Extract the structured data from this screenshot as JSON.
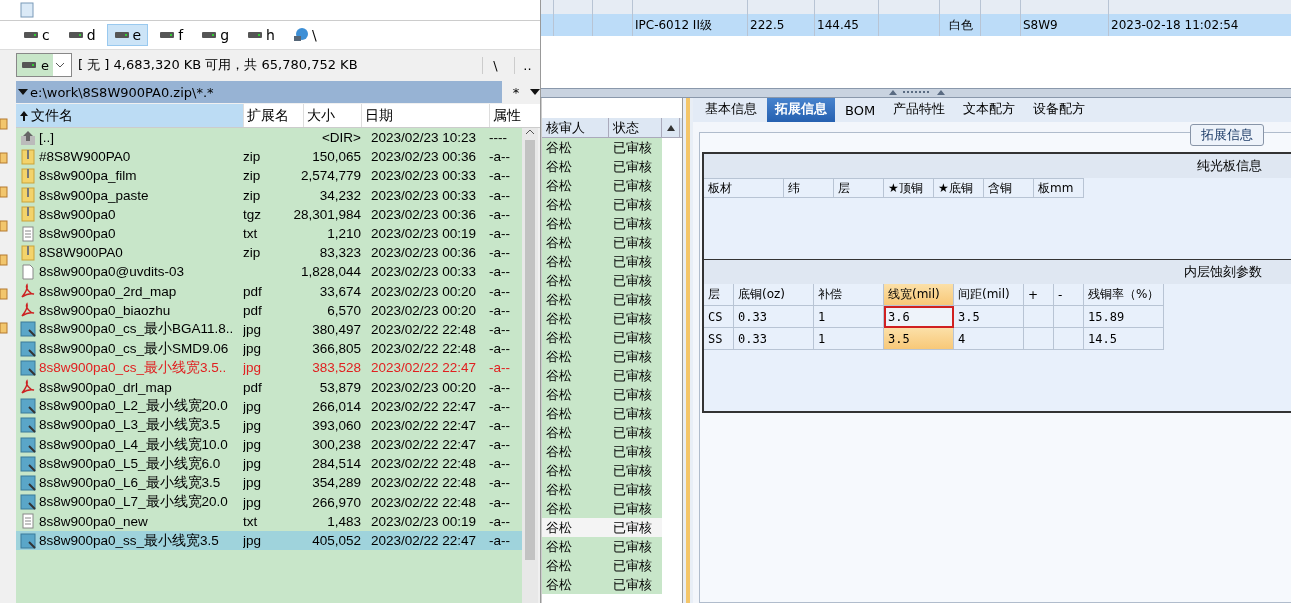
{
  "file_panel": {
    "drives": [
      {
        "kind": "drive",
        "label": "c",
        "selected": false
      },
      {
        "kind": "drive",
        "label": "d",
        "selected": false
      },
      {
        "kind": "drive",
        "label": "e",
        "selected": true
      },
      {
        "kind": "drive",
        "label": "f",
        "selected": false
      },
      {
        "kind": "drive",
        "label": "g",
        "selected": false
      },
      {
        "kind": "drive",
        "label": "h",
        "selected": false
      },
      {
        "kind": "network",
        "label": "\\",
        "selected": false
      }
    ],
    "drive_select": {
      "value": "e"
    },
    "free_space": "[ 无 ]  4,683,320 KB 可用，共 65,780,752 KB",
    "root_button": "\\",
    "up_button": "..",
    "path": "e:\\work\\8S8W900PA0.zip\\*.*",
    "filter": "*",
    "columns": [
      "文件名",
      "扩展名",
      "大小",
      "日期",
      "属性"
    ],
    "files": [
      {
        "kind": "up",
        "name": "[..]",
        "size": "<DIR>",
        "date": "2023/02/23 10:23",
        "attr": "----",
        "marked": false,
        "selected": false
      },
      {
        "kind": "zip",
        "name": "#8S8W900PA0",
        "ext": "zip",
        "size": "150,065",
        "date": "2023/02/23 00:36",
        "attr": "-a--",
        "marked": false,
        "selected": false
      },
      {
        "kind": "zip",
        "name": "8s8w900pa_film",
        "ext": "zip",
        "size": "2,574,779",
        "date": "2023/02/23 00:33",
        "attr": "-a--",
        "marked": false,
        "selected": false
      },
      {
        "kind": "zip",
        "name": "8s8w900pa_paste",
        "ext": "zip",
        "size": "34,232",
        "date": "2023/02/23 00:33",
        "attr": "-a--",
        "marked": false,
        "selected": false
      },
      {
        "kind": "zip",
        "name": "8s8w900pa0",
        "ext": "tgz",
        "size": "28,301,984",
        "date": "2023/02/23 00:36",
        "attr": "-a--",
        "marked": false,
        "selected": false
      },
      {
        "kind": "txt",
        "name": "8s8w900pa0",
        "ext": "txt",
        "size": "1,210",
        "date": "2023/02/23 00:19",
        "attr": "-a--",
        "marked": false,
        "selected": false
      },
      {
        "kind": "zip",
        "name": "8S8W900PA0",
        "ext": "zip",
        "size": "83,323",
        "date": "2023/02/23 00:36",
        "attr": "-a--",
        "marked": false,
        "selected": false
      },
      {
        "kind": "file",
        "name": "8s8w900pa0@uvdits-03",
        "size": "1,828,044",
        "date": "2023/02/23 00:33",
        "attr": "-a--",
        "marked": false,
        "selected": false
      },
      {
        "kind": "pdf",
        "name": "8s8w900pa0_2rd_map",
        "ext": "pdf",
        "size": "33,674",
        "date": "2023/02/23 00:20",
        "attr": "-a--",
        "marked": false,
        "selected": false
      },
      {
        "kind": "pdf",
        "name": "8s8w900pa0_biaozhu",
        "ext": "pdf",
        "size": "6,570",
        "date": "2023/02/23 00:20",
        "attr": "-a--",
        "marked": false,
        "selected": false
      },
      {
        "kind": "jpg",
        "name": "8s8w900pa0_cs_最小BGA11.8..",
        "ext": "jpg",
        "size": "380,497",
        "date": "2023/02/22 22:48",
        "attr": "-a--",
        "marked": false,
        "selected": false
      },
      {
        "kind": "jpg",
        "name": "8s8w900pa0_cs_最小SMD9.06",
        "ext": "jpg",
        "size": "366,805",
        "date": "2023/02/22 22:48",
        "attr": "-a--",
        "marked": false,
        "selected": false
      },
      {
        "kind": "jpg",
        "name": "8s8w900pa0_cs_最小线宽3.5..",
        "ext": "jpg",
        "size": "383,528",
        "date": "2023/02/22 22:47",
        "attr": "-a--",
        "marked": true,
        "selected": false
      },
      {
        "kind": "pdf",
        "name": "8s8w900pa0_drl_map",
        "ext": "pdf",
        "size": "53,879",
        "date": "2023/02/23 00:20",
        "attr": "-a--",
        "marked": false,
        "selected": false
      },
      {
        "kind": "jpg",
        "name": "8s8w900pa0_L2_最小线宽20.0",
        "ext": "jpg",
        "size": "266,014",
        "date": "2023/02/22 22:47",
        "attr": "-a--",
        "marked": false,
        "selected": false
      },
      {
        "kind": "jpg",
        "name": "8s8w900pa0_L3_最小线宽3.5",
        "ext": "jpg",
        "size": "393,060",
        "date": "2023/02/22 22:47",
        "attr": "-a--",
        "marked": false,
        "selected": false
      },
      {
        "kind": "jpg",
        "name": "8s8w900pa0_L4_最小线宽10.0",
        "ext": "jpg",
        "size": "300,238",
        "date": "2023/02/22 22:47",
        "attr": "-a--",
        "marked": false,
        "selected": false
      },
      {
        "kind": "jpg",
        "name": "8s8w900pa0_L5_最小线宽6.0",
        "ext": "jpg",
        "size": "284,514",
        "date": "2023/02/22 22:48",
        "attr": "-a--",
        "marked": false,
        "selected": false
      },
      {
        "kind": "jpg",
        "name": "8s8w900pa0_L6_最小线宽3.5",
        "ext": "jpg",
        "size": "354,289",
        "date": "2023/02/22 22:48",
        "attr": "-a--",
        "marked": false,
        "selected": false
      },
      {
        "kind": "jpg",
        "name": "8s8w900pa0_L7_最小线宽20.0",
        "ext": "jpg",
        "size": "266,970",
        "date": "2023/02/22 22:48",
        "attr": "-a--",
        "marked": false,
        "selected": false
      },
      {
        "kind": "txt",
        "name": "8s8w900pa0_new",
        "ext": "txt",
        "size": "1,483",
        "date": "2023/02/23 00:19",
        "attr": "-a--",
        "marked": false,
        "selected": false
      },
      {
        "kind": "jpg",
        "name": "8s8w900pa0_ss_最小线宽3.5",
        "ext": "jpg",
        "size": "405,052",
        "date": "2023/02/22 22:47",
        "attr": "-a--",
        "marked": false,
        "selected": true
      }
    ]
  },
  "order_grid": {
    "rows": [
      {
        "selected": true,
        "cells": [
          "",
          "",
          "IPC-6012 II级",
          "222.5",
          "144.45",
          "",
          "白色",
          "",
          "S8W9",
          "2023-02-18 11:02:54"
        ]
      }
    ]
  },
  "review_list": {
    "columns": [
      "核审人",
      "状态"
    ],
    "rows": [
      {
        "reviewer": "谷松",
        "status": "已审核",
        "selected": false
      },
      {
        "reviewer": "谷松",
        "status": "已审核",
        "selected": false
      },
      {
        "reviewer": "谷松",
        "status": "已审核",
        "selected": false
      },
      {
        "reviewer": "谷松",
        "status": "已审核",
        "selected": false
      },
      {
        "reviewer": "谷松",
        "status": "已审核",
        "selected": false
      },
      {
        "reviewer": "谷松",
        "status": "已审核",
        "selected": false
      },
      {
        "reviewer": "谷松",
        "status": "已审核",
        "selected": false
      },
      {
        "reviewer": "谷松",
        "status": "已审核",
        "selected": false
      },
      {
        "reviewer": "谷松",
        "status": "已审核",
        "selected": false
      },
      {
        "reviewer": "谷松",
        "status": "已审核",
        "selected": false
      },
      {
        "reviewer": "谷松",
        "status": "已审核",
        "selected": false
      },
      {
        "reviewer": "谷松",
        "status": "已审核",
        "selected": false
      },
      {
        "reviewer": "谷松",
        "status": "已审核",
        "selected": false
      },
      {
        "reviewer": "谷松",
        "status": "已审核",
        "selected": false
      },
      {
        "reviewer": "谷松",
        "status": "已审核",
        "selected": false
      },
      {
        "reviewer": "谷松",
        "status": "已审核",
        "selected": false
      },
      {
        "reviewer": "谷松",
        "status": "已审核",
        "selected": false
      },
      {
        "reviewer": "谷松",
        "status": "已审核",
        "selected": false
      },
      {
        "reviewer": "谷松",
        "status": "已审核",
        "selected": false
      },
      {
        "reviewer": "谷松",
        "status": "已审核",
        "selected": false
      },
      {
        "reviewer": "谷松",
        "status": "已审核",
        "selected": true
      },
      {
        "reviewer": "谷松",
        "status": "已审核",
        "selected": false
      },
      {
        "reviewer": "谷松",
        "status": "已审核",
        "selected": false
      },
      {
        "reviewer": "谷松",
        "status": "已审核",
        "selected": false
      }
    ]
  },
  "detail": {
    "tabs": [
      {
        "label": "基本信息",
        "selected": false
      },
      {
        "label": "拓展信息",
        "selected": true
      },
      {
        "label": "BOM",
        "selected": false
      },
      {
        "label": "产品特性",
        "selected": false
      },
      {
        "label": "文本配方",
        "selected": false
      },
      {
        "label": "设备配方",
        "selected": false
      }
    ],
    "group_title": "拓展信息",
    "bare_board": {
      "title": "纯光板信息",
      "columns": [
        "板材",
        "纬",
        "层",
        "★顶铜",
        "★底铜",
        "含铜",
        "板mm"
      ]
    },
    "etching": {
      "title": "内层蚀刻参数",
      "columns": [
        {
          "label": "层",
          "selected": false
        },
        {
          "label": "底铜(oz)",
          "selected": false
        },
        {
          "label": "补偿",
          "selected": false
        },
        {
          "label": "线宽(mil)",
          "selected": true
        },
        {
          "label": "间距(mil)",
          "selected": false
        },
        {
          "label": "+",
          "selected": false
        },
        {
          "label": "-",
          "selected": false
        },
        {
          "label": "残铜率（%）",
          "selected": false
        }
      ],
      "rows": [
        {
          "cells": [
            {
              "text": "CS",
              "focused": false
            },
            {
              "text": "0.33",
              "focused": false
            },
            {
              "text": "1",
              "focused": false
            },
            {
              "text": "3.6",
              "focused": true
            },
            {
              "text": "3.5",
              "focused": false
            },
            {
              "focused": false
            },
            {
              "focused": false
            },
            {
              "text": "15.89",
              "focused": false
            }
          ]
        },
        {
          "cells": [
            {
              "text": "SS",
              "focused": false
            },
            {
              "text": "0.33",
              "focused": false
            },
            {
              "text": "1",
              "focused": false
            },
            {
              "text": "3.5",
              "focused": false
            },
            {
              "text": "4",
              "focused": false
            },
            {
              "focused": false
            },
            {
              "focused": false
            },
            {
              "text": "14.5",
              "focused": false
            }
          ]
        }
      ]
    }
  }
}
